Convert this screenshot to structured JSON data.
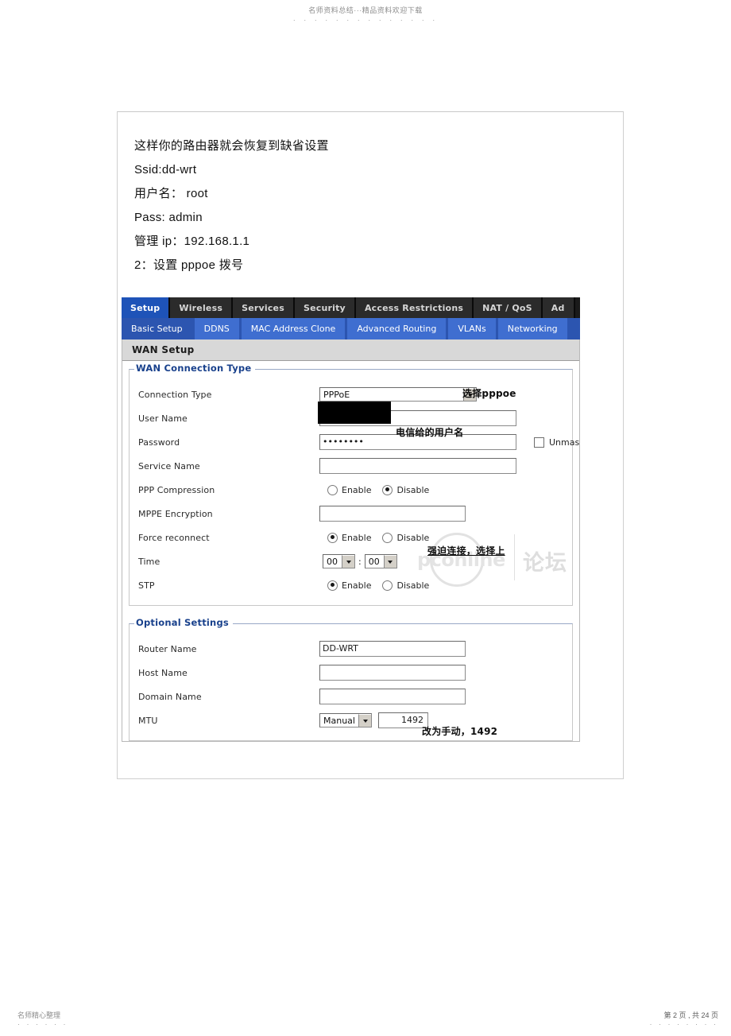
{
  "page": {
    "header_watermark": "名师资料总结···精品资料欢迎下载",
    "header_dots": "· · · · · · · · · · · · · ·",
    "footer_left": "名师精心整理",
    "footer_left_dots": "· · · · · ·",
    "footer_right": "第 2 页 , 共 24 页",
    "footer_right_dots": "· · · · · · · ·"
  },
  "document": {
    "lines": [
      "这样你的路由器就会恢复到缺省设置",
      "Ssid:dd-wrt",
      "用户名： root",
      "Pass: admin",
      "管理 ip：192.168.1.1",
      "2：设置 pppoe 拨号"
    ]
  },
  "router_ui": {
    "main_tabs": [
      {
        "label": "Setup",
        "active": true
      },
      {
        "label": "Wireless",
        "active": false
      },
      {
        "label": "Services",
        "active": false
      },
      {
        "label": "Security",
        "active": false
      },
      {
        "label": "Access Restrictions",
        "active": false
      },
      {
        "label": "NAT / QoS",
        "active": false
      },
      {
        "label": "Ad",
        "active": false
      }
    ],
    "sub_tabs": [
      {
        "label": "Basic Setup",
        "active": true
      },
      {
        "label": "DDNS",
        "active": false
      },
      {
        "label": "MAC Address Clone",
        "active": false
      },
      {
        "label": "Advanced Routing",
        "active": false
      },
      {
        "label": "VLANs",
        "active": false
      },
      {
        "label": "Networking",
        "active": false
      }
    ],
    "page_title": "WAN Setup",
    "wan_connection_type": {
      "legend": "WAN Connection Type",
      "connection_type": {
        "label": "Connection Type",
        "value": "PPPoE"
      },
      "user_name": {
        "label": "User Name",
        "value": ""
      },
      "password": {
        "label": "Password",
        "value": "••••••••",
        "unmask_label": "Unmask",
        "unmask_checked": false
      },
      "service_name": {
        "label": "Service Name",
        "value": ""
      },
      "ppp_compression": {
        "label": "PPP Compression",
        "enable_label": "Enable",
        "disable_label": "Disable",
        "selected": "Disable"
      },
      "mppe_encryption": {
        "label": "MPPE Encryption",
        "value": ""
      },
      "force_reconnect": {
        "label": "Force reconnect",
        "enable_label": "Enable",
        "disable_label": "Disable",
        "selected": "Enable"
      },
      "time": {
        "label": "Time",
        "hours": "00",
        "minutes": "00",
        "separator": ":"
      },
      "stp": {
        "label": "STP",
        "enable_label": "Enable",
        "disable_label": "Disable",
        "selected": "Enable"
      }
    },
    "optional_settings": {
      "legend": "Optional Settings",
      "router_name": {
        "label": "Router Name",
        "value": "DD-WRT"
      },
      "host_name": {
        "label": "Host Name",
        "value": ""
      },
      "domain_name": {
        "label": "Domain Name",
        "value": ""
      },
      "mtu": {
        "label": "MTU",
        "mode": "Manual",
        "value": "1492"
      }
    },
    "annotations": {
      "select_pppoe": {
        "cn": "选择",
        "latin": "pppoe"
      },
      "telecom_username": "电信给的用户名",
      "force_connect": "强迫连接，选择上",
      "mtu_manual": "改为手动，1492"
    },
    "watermark": {
      "brand": "pconline",
      "cn": "论坛"
    }
  },
  "colors": {
    "tab_active": "#1e53b8",
    "tab_inactive": "#2b2b2b",
    "subtab": "#3f6ed0",
    "subtab_active": "#2c55b0",
    "legend_text": "#19418c",
    "section_bar": "#d8d8d8"
  }
}
